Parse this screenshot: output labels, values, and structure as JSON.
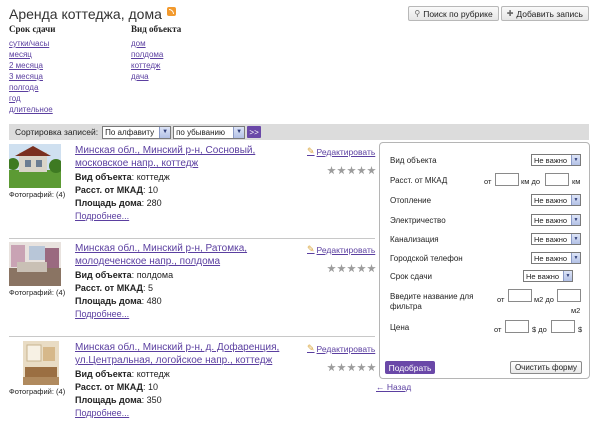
{
  "header": {
    "title": "Аренда коттеджа, дома"
  },
  "top_buttons": {
    "search_by_rubric": "Поиск по рубрике",
    "add_record": "Добавить запись"
  },
  "term": {
    "heading": "Срок сдачи",
    "items": [
      "сутки/часы",
      "месяц",
      "2 месяца",
      "3 месяца",
      "полгода",
      "год",
      "длительное"
    ]
  },
  "object_type": {
    "heading": "Вид объекта",
    "items": [
      "дом",
      "полдома",
      "коттедж",
      "дача"
    ]
  },
  "sort": {
    "label": "Сортировка записей:",
    "field": "По алфавиту",
    "order": "по убыванию",
    "go": ">>"
  },
  "listings": [
    {
      "title": "Минская обл., Минский р-н, Сосновый, московское напр., коттедж",
      "edit": "Редактировать",
      "photos": "Фотографий: (4)",
      "prop1_label": "Вид объекта",
      "prop1_value": "коттедж",
      "prop2_label": "Расст. от МКАД",
      "prop2_value": "10",
      "prop3_label": "Площадь дома",
      "prop3_value": "280",
      "more": "Подробнее...",
      "rating": 5
    },
    {
      "title": "Минская обл., Минский р-н, Ратомка, молодеченское напр., полдома",
      "edit": "Редактировать",
      "photos": "Фотографий: (4)",
      "prop1_label": "Вид объекта",
      "prop1_value": "полдома",
      "prop2_label": "Расст. от МКАД",
      "prop2_value": "5",
      "prop3_label": "Площадь дома",
      "prop3_value": "480",
      "more": "Подробнее...",
      "rating": 5
    },
    {
      "title": "Минская обл., Минский р-н, д. Дофаренция, ул.Центральная, логойское напр., коттедж",
      "edit": "Редактировать",
      "photos": "Фотографий: (4)",
      "prop1_label": "Вид объекта",
      "prop1_value": "коттедж",
      "prop2_label": "Расст. от МКАД",
      "prop2_value": "10",
      "prop3_label": "Площадь дома",
      "prop3_value": "350",
      "more": "Подробнее...",
      "rating": 5
    }
  ],
  "filter": {
    "object_type_label": "Вид объекта",
    "object_type_value": "Не важно",
    "mkad_label": "Расст. от МКАД",
    "from": "от",
    "km_to": "км до",
    "km": "км",
    "heating_label": "Отопление",
    "heating_value": "Не важно",
    "electricity_label": "Электричество",
    "electricity_value": "Не важно",
    "sewage_label": "Канализация",
    "sewage_value": "Не важно",
    "phone_label": "Городской телефон",
    "phone_value": "Не важно",
    "term_label": "Срок сдачи",
    "term_value": "Не важно",
    "name_label_1": "Введите название для",
    "name_label_2": "фильтра",
    "m2_to": "м2 до",
    "m2": "м2",
    "price_label": "Цена",
    "dollar_to": "$ до",
    "dollar": "$",
    "pick_button": "Подобрать",
    "clear_button": "Очистить форму"
  },
  "back_link": "← Назад",
  "colors": {
    "link": "#5b3fa0",
    "button_purple": "#6a48a8",
    "sort_bar": "#dcdcdc"
  }
}
